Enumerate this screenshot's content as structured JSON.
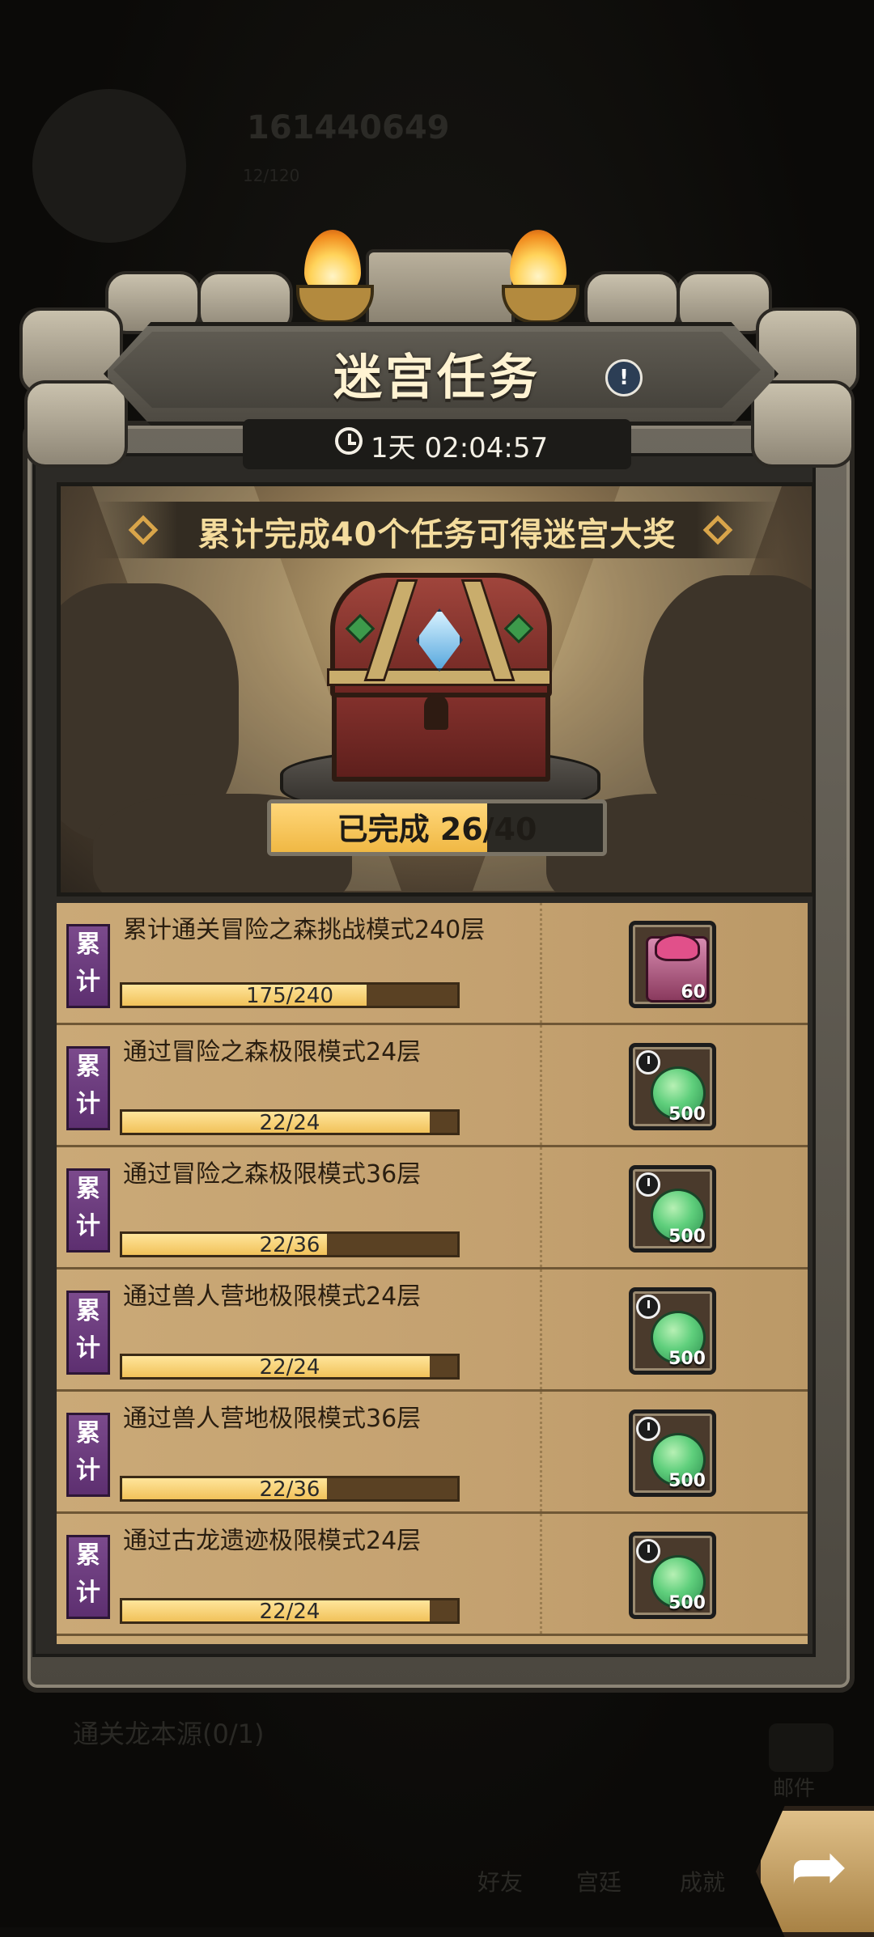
{
  "background": {
    "player_score": "161440649",
    "player_sub": "12/120",
    "quest_text": "通关龙本源(0/1)",
    "mail_label": "邮件",
    "tabs": [
      "好友",
      "宫廷",
      "成就"
    ]
  },
  "panel": {
    "title": "迷宫任务",
    "info_icon": "!",
    "timer": "1天 02:04:57"
  },
  "grand_prize": {
    "banner": "累计完成40个任务可得迷宫大奖",
    "progress_text": "已完成 26/40",
    "completed": 26,
    "total": 40
  },
  "tasks": [
    {
      "tag": "累计",
      "title": "累计通关冒险之森挑战模式240层",
      "progress_text": "175/240",
      "current": 175,
      "target": 240,
      "reward_icon": "gift-chest-icon",
      "reward_count": "60"
    },
    {
      "tag": "累计",
      "title": "通过冒险之森极限模式24层",
      "progress_text": "22/24",
      "current": 22,
      "target": 24,
      "reward_icon": "timed-seed-icon",
      "reward_count": "500"
    },
    {
      "tag": "累计",
      "title": "通过冒险之森极限模式36层",
      "progress_text": "22/36",
      "current": 22,
      "target": 36,
      "reward_icon": "timed-seed-icon",
      "reward_count": "500"
    },
    {
      "tag": "累计",
      "title": "通过兽人营地极限模式24层",
      "progress_text": "22/24",
      "current": 22,
      "target": 24,
      "reward_icon": "timed-seed-icon",
      "reward_count": "500"
    },
    {
      "tag": "累计",
      "title": "通过兽人营地极限模式36层",
      "progress_text": "22/36",
      "current": 22,
      "target": 36,
      "reward_icon": "timed-seed-icon",
      "reward_count": "500"
    },
    {
      "tag": "累计",
      "title": "通过古龙遗迹极限模式24层",
      "progress_text": "22/24",
      "current": 22,
      "target": 24,
      "reward_icon": "timed-seed-icon",
      "reward_count": "500"
    }
  ],
  "colors": {
    "tag_purple": "#6b3b7e",
    "bar_fill": "#f1c25a",
    "bar_track": "#5a4123",
    "title_text": "#fff3d2"
  }
}
